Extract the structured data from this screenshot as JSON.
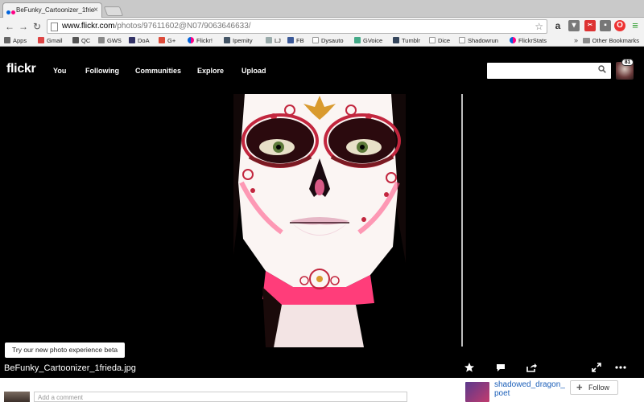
{
  "browser": {
    "tab_title": "BeFunky_Cartoonizer_1frie",
    "url_host": "www.flickr.com",
    "url_path": "/photos/97611602@N07/9063646633/",
    "bookmarks": [
      "Apps",
      "Gmail",
      "QC",
      "GWS",
      "DoA",
      "G+",
      "Flickr!",
      "Ipernity",
      "LJ",
      "FB",
      "Dysauto",
      "GVoice",
      "Tumblr",
      "Dice",
      "Shadowrun",
      "FlickrStats"
    ],
    "bookmarks_more": "»",
    "other_bookmarks": "Other Bookmarks"
  },
  "header": {
    "logo": "flickr",
    "nav": [
      "You",
      "Following",
      "Communities",
      "Explore",
      "Upload"
    ],
    "search_placeholder": "",
    "notification_count": "81"
  },
  "photo": {
    "title": "BeFunky_Cartoonizer_1frieda.jpg",
    "beta_button": "Try our new photo experience beta"
  },
  "comments": {
    "placeholder": "Add a comment"
  },
  "owner": {
    "name": "shadowed_dragon_ poet",
    "follow_label": "Follow",
    "date": ""
  },
  "colors": {
    "flickr_blue": "#0063dc",
    "flickr_pink": "#ff0084",
    "link_blue": "#1a5eb8"
  }
}
